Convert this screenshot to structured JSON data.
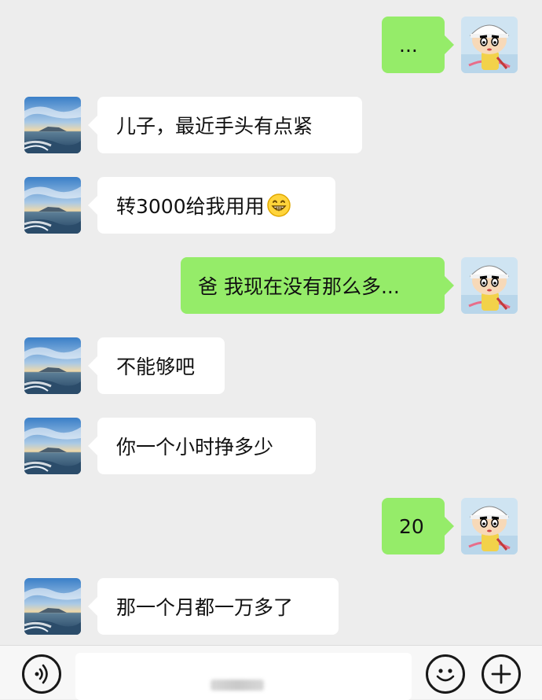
{
  "colors": {
    "background": "#ededed",
    "incoming_bubble": "#ffffff",
    "outgoing_bubble": "#95ec69",
    "text": "#111111"
  },
  "messages": [
    {
      "side": "right",
      "text": "...",
      "avatar_icon": "cartoon-boy-avatar"
    },
    {
      "side": "left",
      "text": "儿子，最近手头有点紧",
      "avatar_icon": "seascape-avatar"
    },
    {
      "side": "left",
      "text": "转3000给我用用",
      "emoji": "grinning-face-emoji",
      "avatar_icon": "seascape-avatar"
    },
    {
      "side": "right",
      "text": "爸 我现在没有那么多...",
      "avatar_icon": "cartoon-boy-avatar"
    },
    {
      "side": "left",
      "text": "不能够吧",
      "avatar_icon": "seascape-avatar"
    },
    {
      "side": "left",
      "text": "你一个小时挣多少",
      "avatar_icon": "seascape-avatar"
    },
    {
      "side": "right",
      "text": "20",
      "avatar_icon": "cartoon-boy-avatar"
    },
    {
      "side": "left",
      "text": "那一个月都一万多了",
      "avatar_icon": "seascape-avatar"
    }
  ],
  "input_bar": {
    "voice_icon": "voice-icon",
    "emoji_icon": "emoji-icon",
    "add_icon": "plus-icon",
    "text_value": ""
  }
}
